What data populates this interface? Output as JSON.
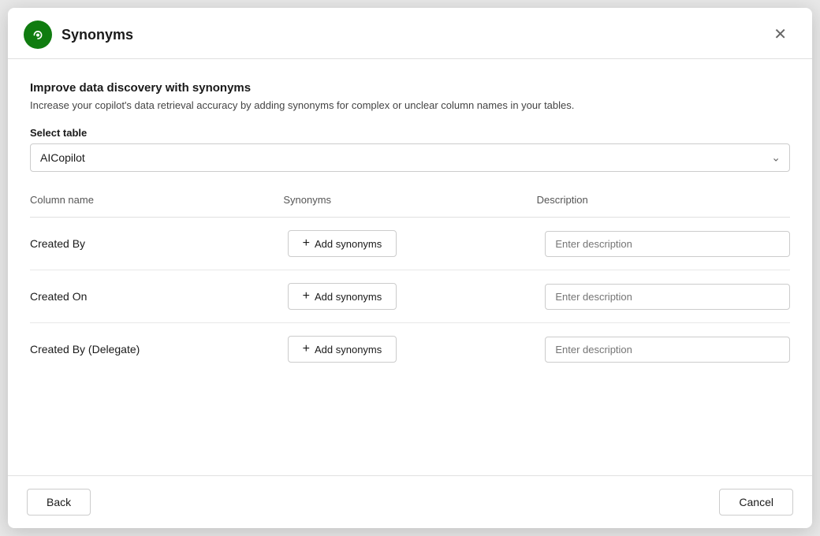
{
  "dialog": {
    "title": "Synonyms",
    "icon_label": "app-icon"
  },
  "content": {
    "heading": "Improve data discovery with synonyms",
    "description": "Increase your copilot's data retrieval accuracy by adding synonyms for complex or unclear column names in your tables.",
    "select_label": "Select table",
    "select_value": "AICopilot",
    "select_options": [
      "AICopilot"
    ],
    "table_headers": {
      "col1": "Column name",
      "col2": "Synonyms",
      "col3": "Description"
    },
    "rows": [
      {
        "column_name": "Created By",
        "add_synonyms_label": "+ Add synonyms",
        "description_placeholder": "Enter description"
      },
      {
        "column_name": "Created On",
        "add_synonyms_label": "+ Add synonyms",
        "description_placeholder": "Enter description"
      },
      {
        "column_name": "Created By (Delegate)",
        "add_synonyms_label": "+ Add synonyms",
        "description_placeholder": "Enter description"
      }
    ]
  },
  "footer": {
    "back_label": "Back",
    "cancel_label": "Cancel"
  }
}
